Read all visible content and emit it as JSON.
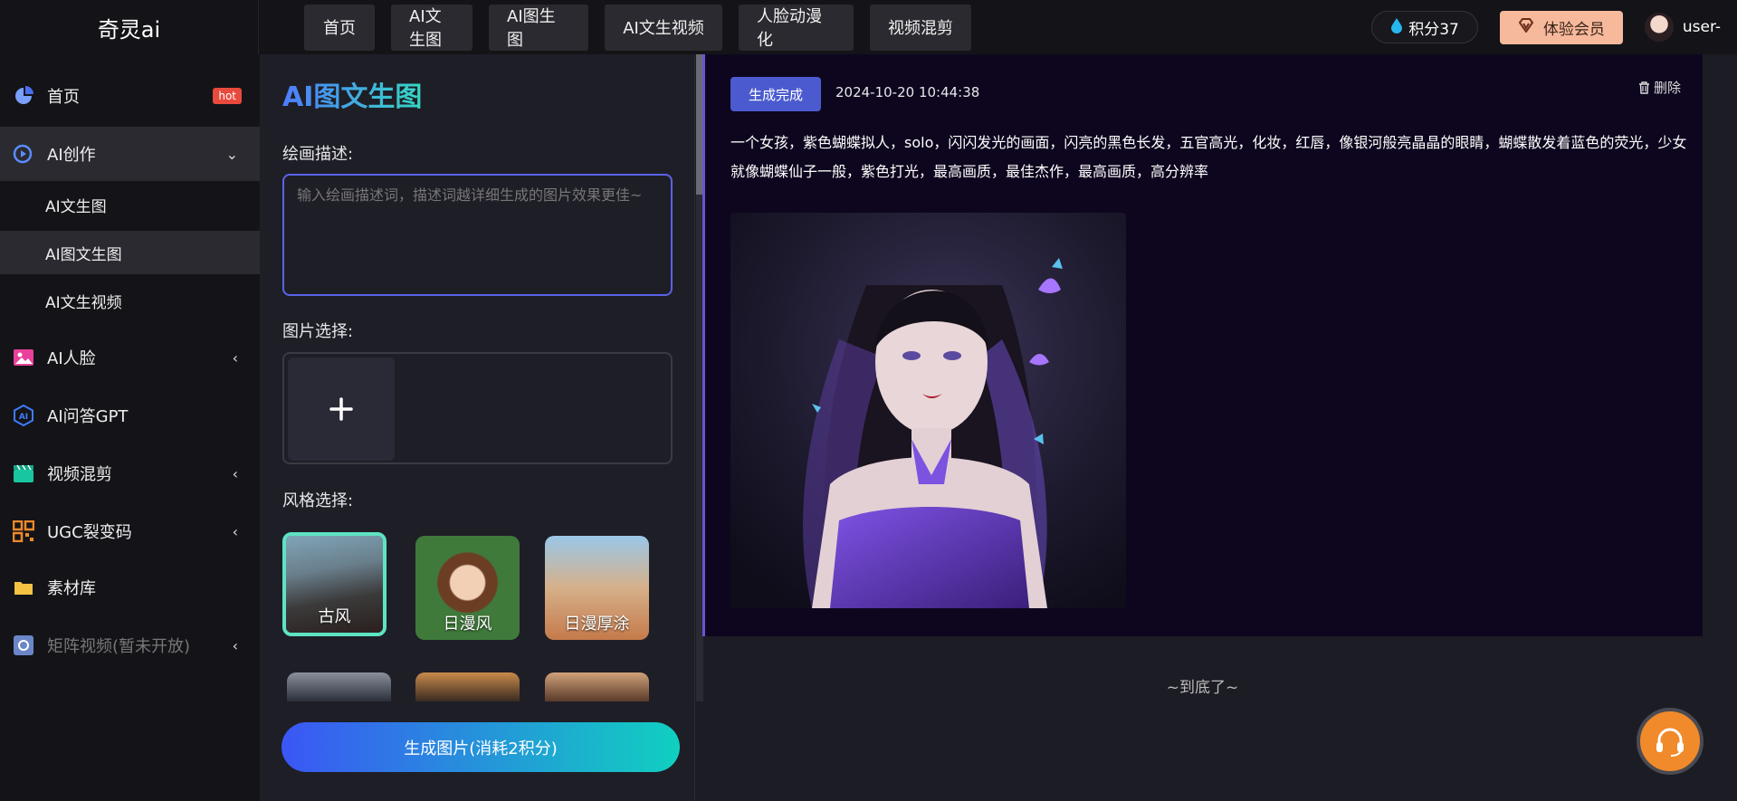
{
  "app": {
    "logo": "奇灵ai"
  },
  "topnav": [
    {
      "label": "首页"
    },
    {
      "label": "AI文生图"
    },
    {
      "label": "AI图生图"
    },
    {
      "label": "AI文生视频"
    },
    {
      "label": "人脸动漫化"
    },
    {
      "label": "视频混剪"
    }
  ],
  "header": {
    "points": "积分37",
    "vip_label": "体验会员",
    "username": "user-"
  },
  "sidebar": {
    "home": "首页",
    "hot_badge": "hot",
    "ai_create": "AI创作",
    "sub": [
      "AI文生图",
      "AI图文生图",
      "AI文生视频"
    ],
    "ai_face": "AI人脸",
    "ai_gpt": "AI问答GPT",
    "video_mix": "视频混剪",
    "ugc": "UGC裂变码",
    "assets": "素材库",
    "matrix": "矩阵视频(暂未开放)"
  },
  "form": {
    "title": "AI图文生图",
    "prompt_label": "绘画描述:",
    "prompt_placeholder": "输入绘画描述词，描述词越详细生成的图片效果更佳~",
    "image_label": "图片选择:",
    "style_label": "风格选择:",
    "styles": [
      {
        "name": "古风"
      },
      {
        "name": "日漫风"
      },
      {
        "name": "日漫厚涂"
      }
    ],
    "generate_label": "生成图片(消耗2积分)"
  },
  "result": {
    "status": "生成完成",
    "time": "2024-10-20 10:44:38",
    "delete_label": "删除",
    "prompt": "一个女孩，紫色蝴蝶拟人，solo，闪闪发光的画面，闪亮的黑色长发，五官高光，化妆，红唇，像银河般亮晶晶的眼睛，蝴蝶散发着蓝色的荧光，少女就像蝴蝶仙子一般，紫色打光，最高画质，最佳杰作，最高画质，高分辨率",
    "end_text": "~到底了~"
  },
  "colors": {
    "accent": "#4b5bcf",
    "vip": "#f7b99c",
    "hot": "#e84a3d",
    "service": "#f08a2a"
  }
}
